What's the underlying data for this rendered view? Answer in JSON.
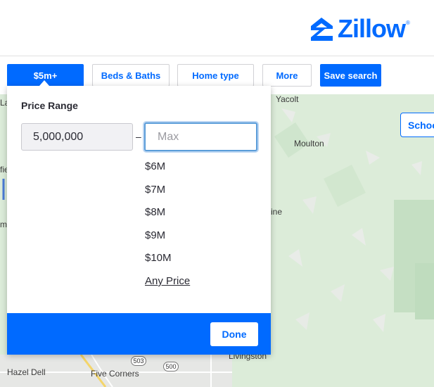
{
  "header": {
    "brand": "Zillow",
    "registered_mark": "®"
  },
  "filters": {
    "price_label": "$5m+",
    "beds_baths_label": "Beds & Baths",
    "home_type_label": "Home type",
    "more_label": "More",
    "save_search_label": "Save search"
  },
  "price_panel": {
    "title": "Price Range",
    "min_value": "5,000,000",
    "separator": "–",
    "max_placeholder": "Max",
    "options": [
      "$6M",
      "$7M",
      "$8M",
      "$9M",
      "$10M",
      "Any Price"
    ],
    "done_label": "Done"
  },
  "map": {
    "schools_label": "Schoo",
    "labels": {
      "yacolt": "Yacolt",
      "moulton": "Moulton",
      "ine": "ine",
      "livingston": "Livingston",
      "hazel_dell": "Hazel Dell",
      "five_corners": "Five Corners",
      "la": "La",
      "fie": "fie",
      "mi": "mi"
    },
    "route_503": "503",
    "route_500": "500"
  },
  "colors": {
    "brand_blue": "#006aff",
    "map_green": "#dfeedf"
  }
}
